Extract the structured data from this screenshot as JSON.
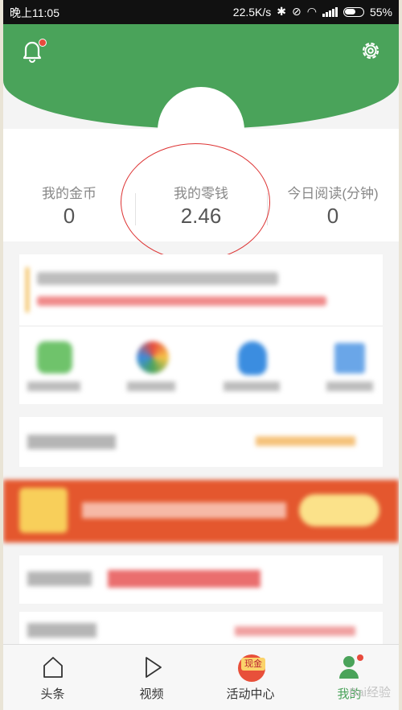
{
  "status_bar": {
    "time": "晚上11:05",
    "network_speed": "22.5K/s",
    "battery": "55%"
  },
  "stats": [
    {
      "label": "我的金币",
      "value": "0"
    },
    {
      "label": "我的零钱",
      "value": "2.46"
    },
    {
      "label": "今日阅读(分钟)",
      "value": "0"
    }
  ],
  "tabs": [
    {
      "label": "头条",
      "icon": "home-icon"
    },
    {
      "label": "视频",
      "icon": "play-icon"
    },
    {
      "label": "活动中心",
      "icon": "cash-gift-icon",
      "badge": "现金"
    },
    {
      "label": "我的",
      "icon": "profile-icon"
    }
  ],
  "watermark": "Bai经验",
  "colors": {
    "brand_green": "#4aa35a",
    "highlight_red": "#d33333",
    "banner_red": "#e4572e"
  }
}
